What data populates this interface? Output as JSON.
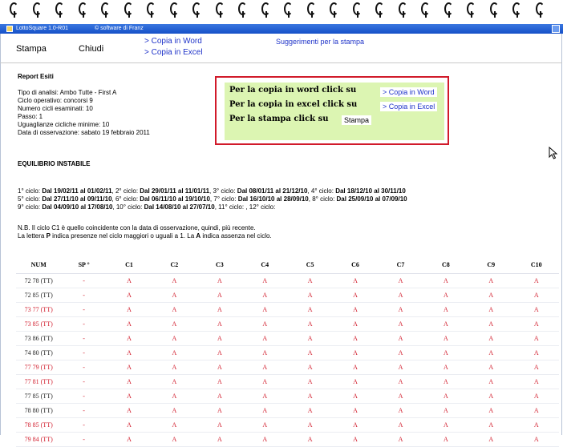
{
  "window": {
    "title": "LottoSquare 1.0-R01",
    "credit": "© software di Franz"
  },
  "toolbar": {
    "stampa": "Stampa",
    "chiudi": "Chiudi",
    "copy_word": "> Copia in Word",
    "copy_excel": "> Copia in Excel",
    "suggestions": "Suggerimenti per la stampa"
  },
  "report": {
    "title": "Report Esiti",
    "info": [
      "Tipo di analisi: Ambo Tutte - First A",
      "Ciclo operativo: concorsi 9",
      "Numero cicli esaminati: 10",
      "Passo: 1",
      "Uguaglianze cicliche minime: 10",
      "Data di osservazione: sabato 19 febbraio 2011"
    ]
  },
  "callout": {
    "row1": "Per la copia in word click su",
    "row2": "Per la copia in excel click su",
    "row3": "Per la stampa click su",
    "word": "> Copia in Word",
    "excel": "> Copia in Excel",
    "stampa": "Stampa"
  },
  "equilibrio": "EQUILIBRIO INSTABILE",
  "cycles": [
    [
      {
        "t": "1° ciclo: ",
        "b": false
      },
      {
        "t": "Dal 19/02/11 al 01/02/11",
        "b": true
      },
      {
        "t": ", 2° ciclo: ",
        "b": false
      },
      {
        "t": "Dal 29/01/11 al 11/01/11",
        "b": true
      },
      {
        "t": ", 3° ciclo: ",
        "b": false
      },
      {
        "t": "Dal 08/01/11 al 21/12/10",
        "b": true
      },
      {
        "t": ", 4° ciclo: ",
        "b": false
      },
      {
        "t": "Dal 18/12/10 al 30/11/10",
        "b": true
      }
    ],
    [
      {
        "t": "5° ciclo: ",
        "b": false
      },
      {
        "t": "Dal 27/11/10 al 09/11/10",
        "b": true
      },
      {
        "t": ", 6° ciclo: ",
        "b": false
      },
      {
        "t": "Dal 06/11/10 al 19/10/10",
        "b": true
      },
      {
        "t": ", 7° ciclo: ",
        "b": false
      },
      {
        "t": "Dal 16/10/10 al 28/09/10",
        "b": true
      },
      {
        "t": ", 8° ciclo: ",
        "b": false
      },
      {
        "t": "Dal 25/09/10 al 07/09/10",
        "b": true
      }
    ],
    [
      {
        "t": "9° ciclo: ",
        "b": false
      },
      {
        "t": "Dal 04/09/10 al 17/08/10",
        "b": true
      },
      {
        "t": ", 10° ciclo: ",
        "b": false
      },
      {
        "t": "Dal 14/08/10 al 27/07/10",
        "b": true
      },
      {
        "t": ", 11° ciclo: , 12° ciclo:",
        "b": false
      }
    ]
  ],
  "notes": {
    "line1": "N.B. Il ciclo C1 è quello coincidente con la data di osservazione, quindi, più recente.",
    "line2": [
      {
        "t": "La lettera ",
        "b": false
      },
      {
        "t": "P",
        "b": true
      },
      {
        "t": " indica presenze nel ciclo maggiori o uguali a 1. La ",
        "b": false
      },
      {
        "t": "A",
        "b": true
      },
      {
        "t": " indica assenza nel ciclo.",
        "b": false
      }
    ]
  },
  "table": {
    "headers": [
      "NUM",
      "SP °",
      "C1",
      "C2",
      "C3",
      "C4",
      "C5",
      "C6",
      "C7",
      "C8",
      "C9",
      "C10"
    ],
    "rows": [
      {
        "num": "72 78 (TT)",
        "hl": false,
        "cells": [
          "-",
          "A",
          "A",
          "A",
          "A",
          "A",
          "A",
          "A",
          "A",
          "A",
          "A"
        ]
      },
      {
        "num": "72 85 (TT)",
        "hl": false,
        "cells": [
          "-",
          "A",
          "A",
          "A",
          "A",
          "A",
          "A",
          "A",
          "A",
          "A",
          "A"
        ]
      },
      {
        "num": "73 77 (TT)",
        "hl": true,
        "cells": [
          "-",
          "A",
          "A",
          "A",
          "A",
          "A",
          "A",
          "A",
          "A",
          "A",
          "A"
        ]
      },
      {
        "num": "73 85 (TT)",
        "hl": true,
        "cells": [
          "-",
          "A",
          "A",
          "A",
          "A",
          "A",
          "A",
          "A",
          "A",
          "A",
          "A"
        ]
      },
      {
        "num": "73 86 (TT)",
        "hl": false,
        "cells": [
          "-",
          "A",
          "A",
          "A",
          "A",
          "A",
          "A",
          "A",
          "A",
          "A",
          "A"
        ]
      },
      {
        "num": "74 80 (TT)",
        "hl": false,
        "cells": [
          "-",
          "A",
          "A",
          "A",
          "A",
          "A",
          "A",
          "A",
          "A",
          "A",
          "A"
        ]
      },
      {
        "num": "77 79 (TT)",
        "hl": true,
        "cells": [
          "-",
          "A",
          "A",
          "A",
          "A",
          "A",
          "A",
          "A",
          "A",
          "A",
          "A"
        ]
      },
      {
        "num": "77 81 (TT)",
        "hl": true,
        "cells": [
          "-",
          "A",
          "A",
          "A",
          "A",
          "A",
          "A",
          "A",
          "A",
          "A",
          "A"
        ]
      },
      {
        "num": "77 85 (TT)",
        "hl": false,
        "cells": [
          "-",
          "A",
          "A",
          "A",
          "A",
          "A",
          "A",
          "A",
          "A",
          "A",
          "A"
        ]
      },
      {
        "num": "78 80 (TT)",
        "hl": false,
        "cells": [
          "-",
          "A",
          "A",
          "A",
          "A",
          "A",
          "A",
          "A",
          "A",
          "A",
          "A"
        ]
      },
      {
        "num": "78 85 (TT)",
        "hl": true,
        "cells": [
          "-",
          "A",
          "A",
          "A",
          "A",
          "A",
          "A",
          "A",
          "A",
          "A",
          "A"
        ]
      },
      {
        "num": "79 84 (TT)",
        "hl": true,
        "cells": [
          "-",
          "A",
          "A",
          "A",
          "A",
          "A",
          "A",
          "A",
          "A",
          "A",
          "A"
        ]
      }
    ]
  },
  "colors": {
    "link_blue": "#1f33c9",
    "absence_red": "#d11a2a",
    "callout_border": "#d11a2a",
    "callout_fill": "#dcf5b2",
    "titlebar": "#1550c8"
  },
  "icons": {
    "spiral": "spiral-binding-ring",
    "cursor": "mouse-pointer-icon",
    "app": "app-icon",
    "window_button": "restore-window-icon"
  }
}
